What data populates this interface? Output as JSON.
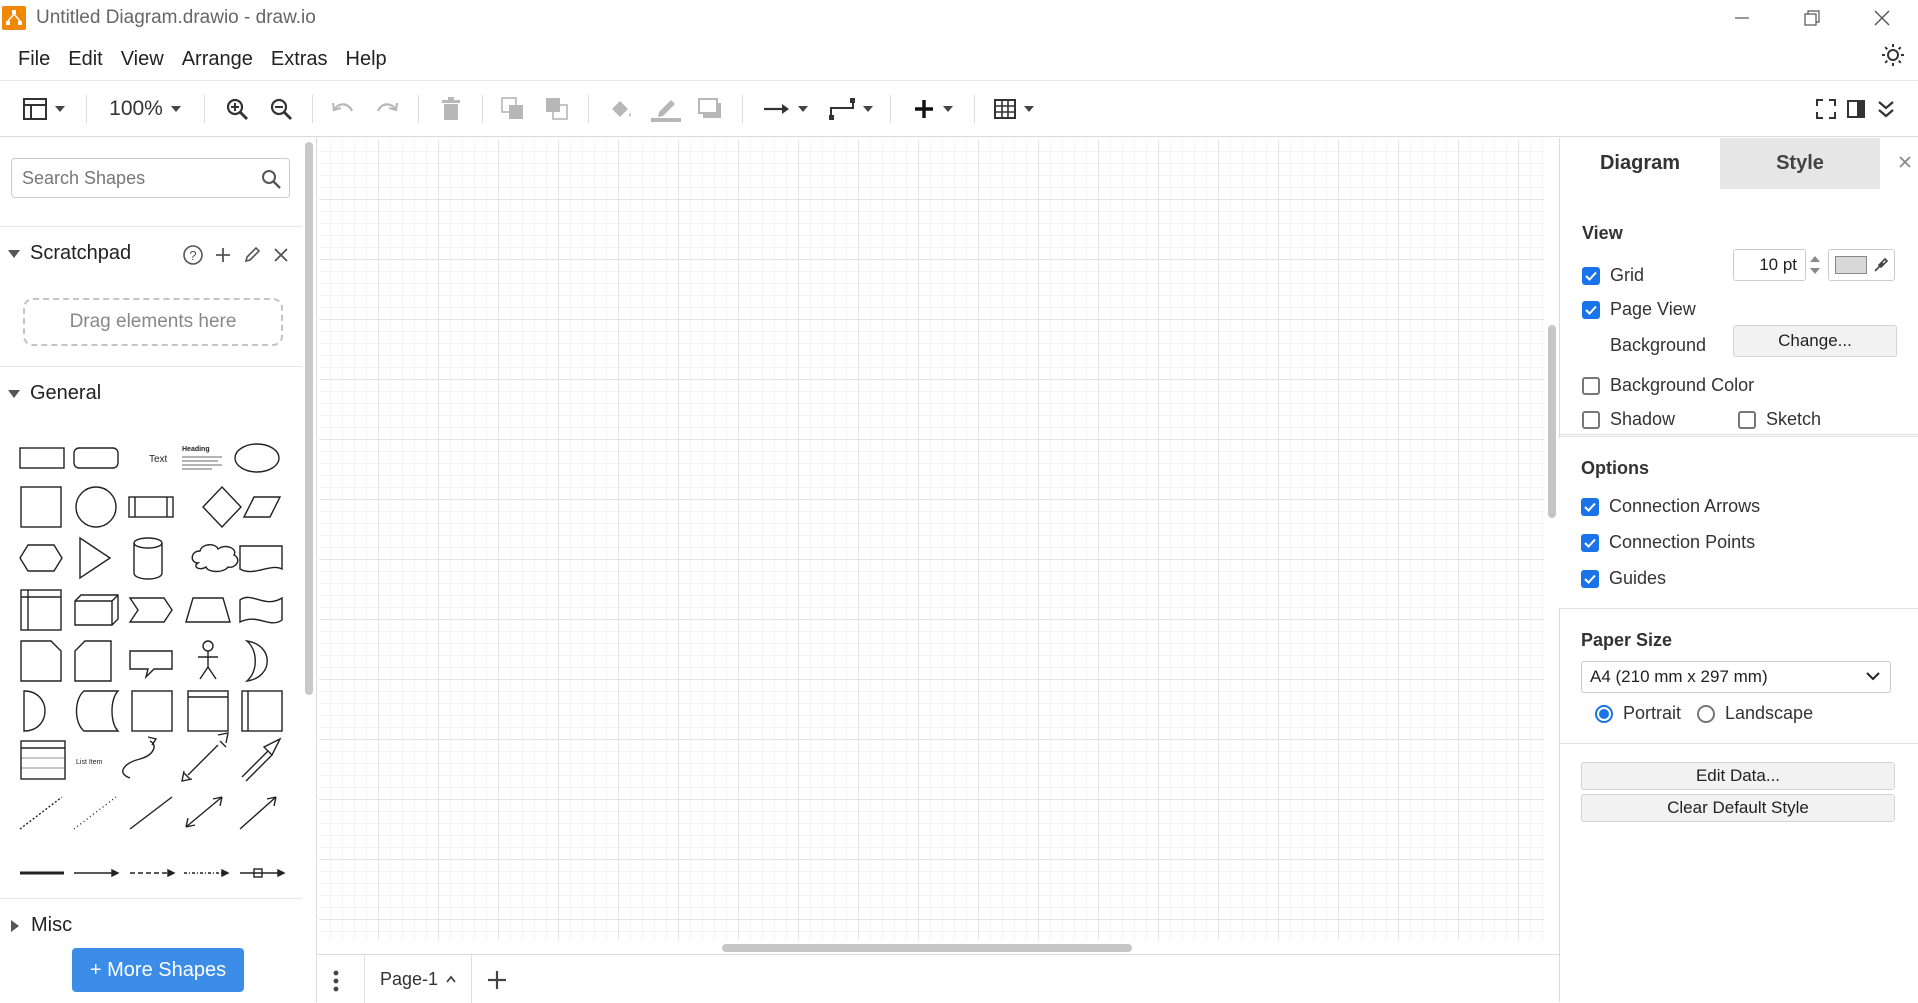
{
  "window": {
    "title": "Untitled Diagram.drawio - draw.io"
  },
  "menu": [
    "File",
    "Edit",
    "View",
    "Arrange",
    "Extras",
    "Help"
  ],
  "toolbar": {
    "zoom": "100%"
  },
  "sidebar": {
    "search_placeholder": "Search Shapes",
    "scratchpad_title": "Scratchpad",
    "dropzone_text": "Drag elements here",
    "general_title": "General",
    "misc_title": "Misc",
    "more_shapes_label": "+ More Shapes",
    "shape_text_label": "Text",
    "shape_heading_label": "Heading",
    "shape_list_item_label": "List Item"
  },
  "pages": {
    "current": "Page-1"
  },
  "format_panel": {
    "tab_diagram": "Diagram",
    "tab_style": "Style",
    "view_title": "View",
    "grid_label": "Grid",
    "grid_checked": true,
    "grid_size": "10 pt",
    "page_view_label": "Page View",
    "page_view_checked": true,
    "background_label": "Background",
    "change_button": "Change...",
    "background_color_label": "Background Color",
    "background_color_checked": false,
    "shadow_label": "Shadow",
    "shadow_checked": false,
    "sketch_label": "Sketch",
    "sketch_checked": false,
    "options_title": "Options",
    "connection_arrows_label": "Connection Arrows",
    "connection_points_label": "Connection Points",
    "guides_label": "Guides",
    "paper_size_title": "Paper Size",
    "paper_size_value": "A4 (210 mm x 297 mm)",
    "portrait_label": "Portrait",
    "landscape_label": "Landscape",
    "orientation": "Portrait",
    "edit_data_button": "Edit Data...",
    "clear_default_style_button": "Clear Default Style",
    "accent_color": "#1a73e8"
  }
}
